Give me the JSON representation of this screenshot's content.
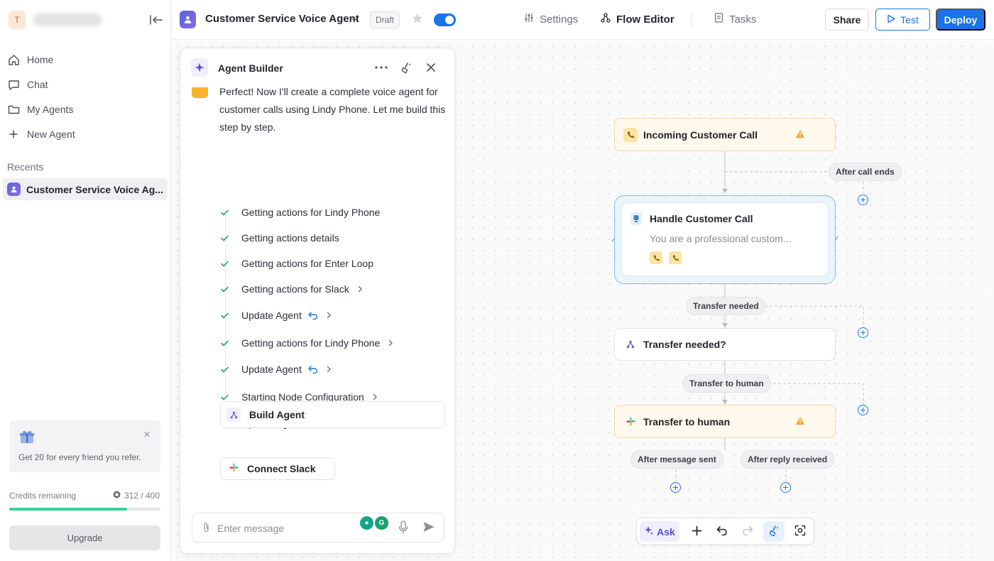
{
  "sidebar": {
    "workspace_initial": "T",
    "nav": [
      {
        "label": "Home",
        "icon": "home-icon"
      },
      {
        "label": "Chat",
        "icon": "chat-icon"
      },
      {
        "label": "My Agents",
        "icon": "folder-icon"
      },
      {
        "label": "New Agent",
        "icon": "plus-icon"
      }
    ],
    "recents_label": "Recents",
    "recent_item": "Customer Service Voice Ag...",
    "refer_text": "Get 20 for every friend you refer.",
    "credits_label": "Credits remaining",
    "credits_value": "312 / 400",
    "credits_used": 312,
    "credits_total": 400,
    "upgrade_label": "Upgrade"
  },
  "topbar": {
    "agent_title": "Customer Service Voice Agent",
    "status_badge": "Draft",
    "enabled": true,
    "tabs": [
      {
        "label": "Settings",
        "icon": "sliders-icon",
        "active": false
      },
      {
        "label": "Flow Editor",
        "icon": "flow-icon",
        "active": true
      },
      {
        "label": "Tasks",
        "icon": "document-icon",
        "active": false
      }
    ],
    "share_label": "Share",
    "test_label": "Test",
    "deploy_label": "Deploy"
  },
  "builder": {
    "title": "Agent Builder",
    "message": "Perfect! Now I'll create a complete voice agent for customer calls using Lindy Phone. Let me build this step by step.",
    "steps": [
      {
        "label": "Getting actions for Lindy Phone",
        "undo": false,
        "chevron": false
      },
      {
        "label": "Getting actions details",
        "undo": false,
        "chevron": false
      },
      {
        "label": "Getting actions for Enter Loop",
        "undo": false,
        "chevron": false
      },
      {
        "label": "Getting actions for Slack",
        "undo": false,
        "chevron": true
      },
      {
        "label": "Update Agent",
        "undo": true,
        "chevron": true
      },
      {
        "label": "Getting actions for Lindy Phone",
        "undo": false,
        "chevron": true
      },
      {
        "label": "Update Agent",
        "undo": true,
        "chevron": true
      },
      {
        "label": "Starting Node Configuration",
        "undo": false,
        "chevron": true
      },
      {
        "label": "Update Agent",
        "undo": true,
        "chevron": true
      }
    ],
    "build_agent_label": "Build Agent",
    "connect_slack_label": "Connect Slack",
    "input_placeholder": "Enter message",
    "input_value": ""
  },
  "flow": {
    "trigger": {
      "label": "Incoming Customer Call",
      "warning": true
    },
    "edge_after_call": "After call ends",
    "loop_node": {
      "title": "Handle Customer Call",
      "subtitle": "You are a professional custom..."
    },
    "edge_transfer_needed": "Transfer needed",
    "condition_node": {
      "label": "Transfer needed?"
    },
    "edge_transfer_human": "Transfer to human",
    "action_node": {
      "label": "Transfer to human",
      "warning": true
    },
    "edge_after_message": "After message sent",
    "edge_after_reply": "After reply received"
  },
  "canvas_toolbar": {
    "ask_label": "Ask"
  },
  "colors": {
    "accent": "#1a73e8",
    "warning": "#f5a623",
    "success": "#3ecf97",
    "loop_border": "#7ec2dd"
  }
}
